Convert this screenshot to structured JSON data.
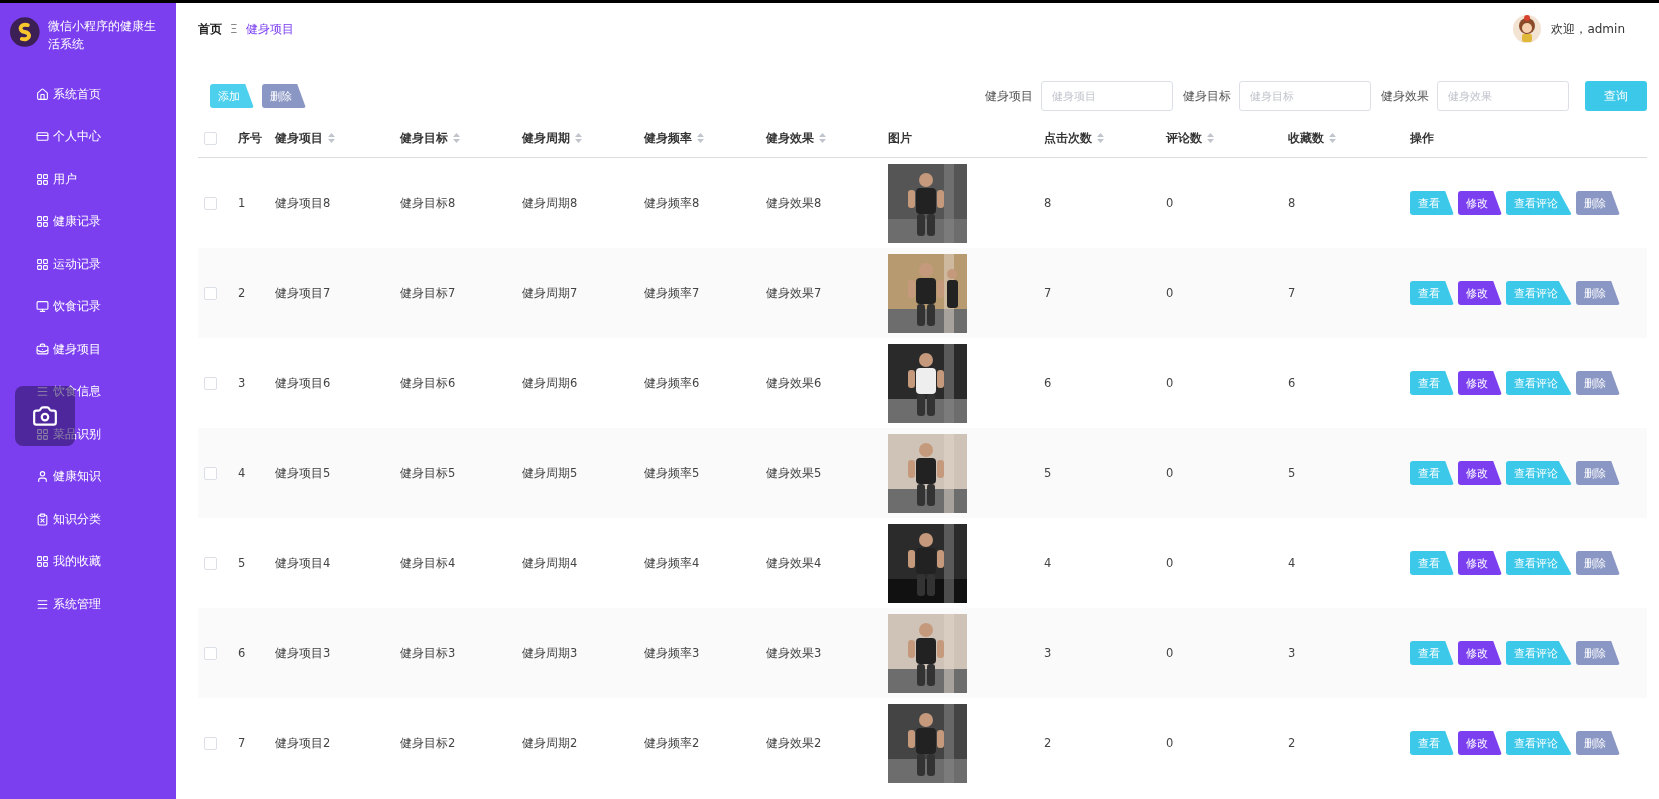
{
  "app": {
    "title": "微信小程序的健康生活系统"
  },
  "sidebar": {
    "items": [
      {
        "label": "系统首页"
      },
      {
        "label": "个人中心"
      },
      {
        "label": "用户"
      },
      {
        "label": "健康记录"
      },
      {
        "label": "运动记录"
      },
      {
        "label": "饮食记录"
      },
      {
        "label": "健身项目"
      },
      {
        "label": "饮食信息"
      },
      {
        "label": "菜品识别"
      },
      {
        "label": "健康知识"
      },
      {
        "label": "知识分类"
      },
      {
        "label": "我的收藏"
      },
      {
        "label": "系统管理"
      }
    ]
  },
  "breadcrumb": {
    "home": "首页",
    "separator": "Ξ",
    "current": "健身项目"
  },
  "user": {
    "greeting": "欢迎，admin"
  },
  "toolbar": {
    "buttons": [
      {
        "label": "添加",
        "kind": "add"
      },
      {
        "label": "删除",
        "kind": "delete"
      }
    ]
  },
  "filters": [
    {
      "label": "健身项目",
      "placeholder": "健身项目"
    },
    {
      "label": "健身目标",
      "placeholder": "健身目标"
    },
    {
      "label": "健身效果",
      "placeholder": "健身效果"
    }
  ],
  "search_button": "查询",
  "table": {
    "columns": [
      {
        "label": "序号",
        "sortable": false
      },
      {
        "label": "健身项目",
        "sortable": true
      },
      {
        "label": "健身目标",
        "sortable": true
      },
      {
        "label": "健身周期",
        "sortable": true
      },
      {
        "label": "健身频率",
        "sortable": true
      },
      {
        "label": "健身效果",
        "sortable": true
      },
      {
        "label": "图片",
        "sortable": false
      },
      {
        "label": "点击次数",
        "sortable": true
      },
      {
        "label": "评论数",
        "sortable": true
      },
      {
        "label": "收藏数",
        "sortable": true
      },
      {
        "label": "操作",
        "sortable": false
      }
    ],
    "header_checked": false,
    "rows": [
      {
        "checked": false,
        "cells": [
          "1",
          "健身项目8",
          "健身目标8",
          "健身周期8",
          "健身频率8",
          "健身效果8",
          {
            "kind": "picture"
          },
          "8",
          "0",
          "8",
          [
            {
              "label": "查看",
              "kind": "view"
            },
            {
              "label": "修改",
              "kind": "edit"
            },
            {
              "label": "查看评论",
              "kind": "view"
            },
            {
              "label": "删除",
              "kind": "delete"
            }
          ]
        ]
      },
      {
        "checked": false,
        "cells": [
          "2",
          "健身项目7",
          "健身目标7",
          "健身周期7",
          "健身频率7",
          "健身效果7",
          {
            "kind": "picture"
          },
          "7",
          "0",
          "7",
          [
            {
              "label": "查看",
              "kind": "view"
            },
            {
              "label": "修改",
              "kind": "edit"
            },
            {
              "label": "查看评论",
              "kind": "view"
            },
            {
              "label": "删除",
              "kind": "delete"
            }
          ]
        ]
      },
      {
        "checked": false,
        "cells": [
          "3",
          "健身项目6",
          "健身目标6",
          "健身周期6",
          "健身频率6",
          "健身效果6",
          {
            "kind": "picture"
          },
          "6",
          "0",
          "6",
          [
            {
              "label": "查看",
              "kind": "view"
            },
            {
              "label": "修改",
              "kind": "edit"
            },
            {
              "label": "查看评论",
              "kind": "view"
            },
            {
              "label": "删除",
              "kind": "delete"
            }
          ]
        ]
      },
      {
        "checked": false,
        "cells": [
          "4",
          "健身项目5",
          "健身目标5",
          "健身周期5",
          "健身频率5",
          "健身效果5",
          {
            "kind": "picture"
          },
          "5",
          "0",
          "5",
          [
            {
              "label": "查看",
              "kind": "view"
            },
            {
              "label": "修改",
              "kind": "edit"
            },
            {
              "label": "查看评论",
              "kind": "view"
            },
            {
              "label": "删除",
              "kind": "delete"
            }
          ]
        ]
      },
      {
        "checked": false,
        "cells": [
          "5",
          "健身项目4",
          "健身目标4",
          "健身周期4",
          "健身频率4",
          "健身效果4",
          {
            "kind": "picture"
          },
          "4",
          "0",
          "4",
          [
            {
              "label": "查看",
              "kind": "view"
            },
            {
              "label": "修改",
              "kind": "edit"
            },
            {
              "label": "查看评论",
              "kind": "view"
            },
            {
              "label": "删除",
              "kind": "delete"
            }
          ]
        ]
      },
      {
        "checked": false,
        "cells": [
          "6",
          "健身项目3",
          "健身目标3",
          "健身周期3",
          "健身频率3",
          "健身效果3",
          {
            "kind": "picture"
          },
          "3",
          "0",
          "3",
          [
            {
              "label": "查看",
              "kind": "view"
            },
            {
              "label": "修改",
              "kind": "edit"
            },
            {
              "label": "查看评论",
              "kind": "view"
            },
            {
              "label": "删除",
              "kind": "delete"
            }
          ]
        ]
      },
      {
        "checked": false,
        "cells": [
          "7",
          "健身项目2",
          "健身目标2",
          "健身周期2",
          "健身频率2",
          "健身效果2",
          {
            "kind": "picture"
          },
          "2",
          "0",
          "2",
          [
            {
              "label": "查看",
              "kind": "view"
            },
            {
              "label": "修改",
              "kind": "edit"
            },
            {
              "label": "查看评论",
              "kind": "view"
            },
            {
              "label": "删除",
              "kind": "delete"
            }
          ]
        ]
      }
    ]
  }
}
